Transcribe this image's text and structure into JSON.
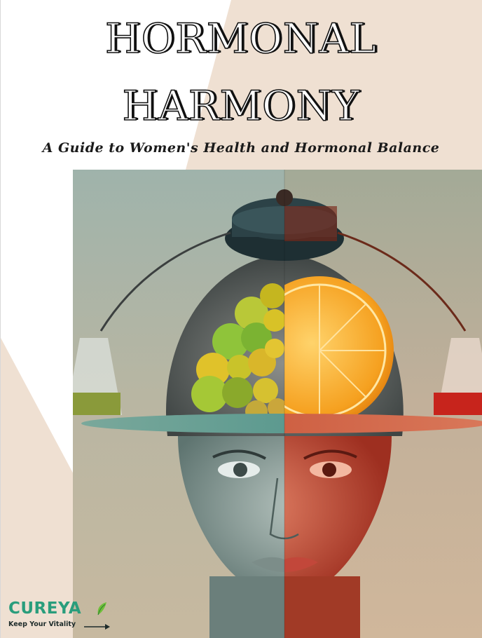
{
  "cover": {
    "title_line1": "HORMONAL",
    "title_line2": "HARMONY",
    "subtitle": "A Guide to Women's Health and Hormonal Balance",
    "image_subject": "woman-face-with-balance-scale-fruit-and-orange"
  },
  "brand": {
    "name": "CUREYA",
    "tagline": "Keep Your Vitality",
    "accent_color": "#2a9d7c",
    "leaf_icon": "leaf-icon",
    "arrow_icon": "arrow-right-icon"
  },
  "colors": {
    "background_beige": "#efe0d2",
    "background_white": "#ffffff",
    "cool_tone": "#6f8a86",
    "warm_tone": "#d44a35",
    "orange": "#f39a1b",
    "green_fruit": "#8fc43a"
  }
}
